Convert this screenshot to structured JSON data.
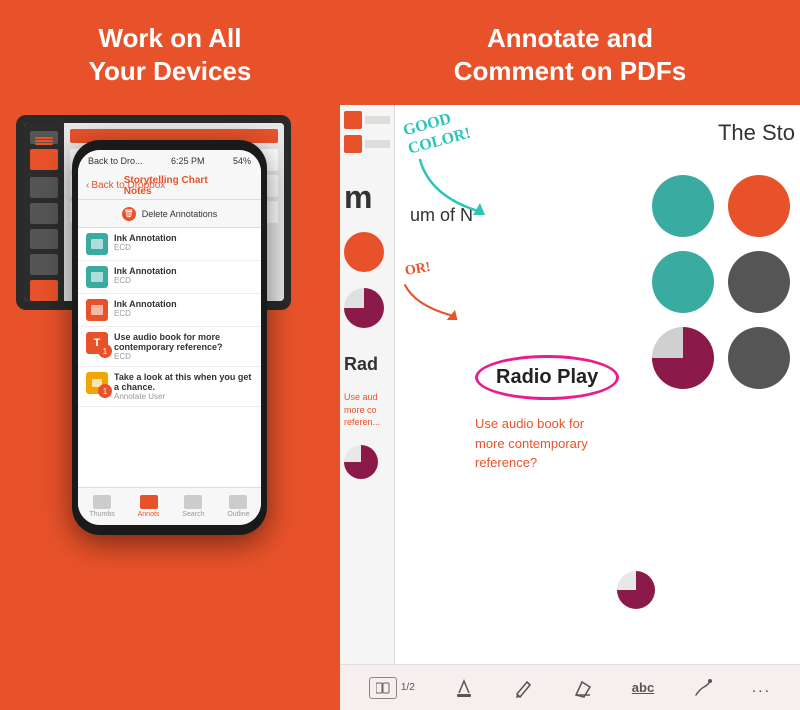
{
  "left": {
    "header_line1": "Work on All",
    "header_line2": "Your Devices",
    "phone": {
      "status_left": "Back to Dro...",
      "status_time": "6:25 PM",
      "status_battery": "54%",
      "nav_back": "Back to Dropbox",
      "nav_title": "Storytelling Chart Notes",
      "delete_button": "Delete Annotations",
      "annotations": [
        {
          "type": "ink",
          "title": "Ink Annotation",
          "sub": "ECD",
          "badge": ""
        },
        {
          "type": "ink",
          "title": "Ink Annotation",
          "sub": "ECD",
          "badge": ""
        },
        {
          "type": "ink",
          "title": "Ink Annotation",
          "sub": "ECD",
          "badge": ""
        },
        {
          "type": "text",
          "title": "Use audio book for more contemporary reference?",
          "sub": "ECD",
          "badge": "1"
        },
        {
          "type": "chat",
          "title": "Take a look at this when you get a chance.",
          "sub": "Annotate User",
          "badge": "1"
        }
      ],
      "bottom_tabs": [
        {
          "label": "Thumbs",
          "active": false
        },
        {
          "label": "Annots",
          "active": true
        },
        {
          "label": "Search",
          "active": false
        },
        {
          "label": "Outline",
          "active": false
        }
      ]
    }
  },
  "right": {
    "header_line1": "Annotate and",
    "header_line2": "Comment on PDFs",
    "pdf": {
      "title": "The Sto",
      "handwriting": "GOOD\nCOLOR!",
      "radio_play_label": "Radio Play",
      "audio_book_text": "Use audio book for\nmore contemporary\nreference?",
      "color_or_label": "OR!",
      "rad_partial": "Rad",
      "use_aud_partial": "Use aud\nmore co\nreferen..."
    },
    "toolbar": {
      "page_count": "1/2",
      "abc_label": "abc",
      "dots_label": "..."
    }
  }
}
